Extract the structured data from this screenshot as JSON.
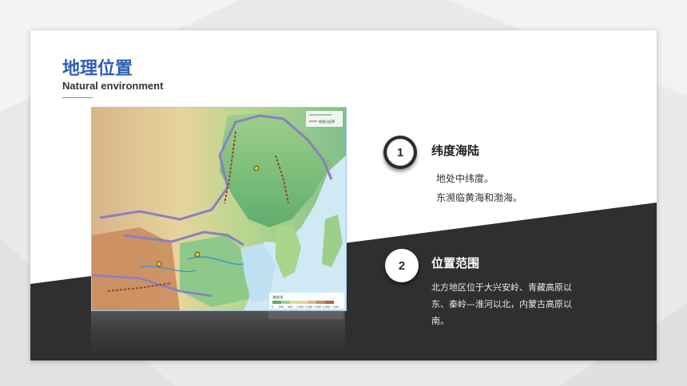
{
  "header": {
    "title": "地理位置",
    "subtitle": "Natural environment"
  },
  "map": {
    "legend_label": "地理分区界",
    "elevation_label": "海拔/米",
    "elevation_ticks": [
      "0",
      "200",
      "500",
      "1 000",
      "2 000",
      "3 000",
      "4 000",
      "7 000"
    ]
  },
  "points": [
    {
      "number": "1",
      "heading": "纬度海陆",
      "lines": [
        "地处中纬度。",
        "东濒临黄海和渤海。"
      ]
    },
    {
      "number": "2",
      "heading": "位置范围",
      "lines": [
        "北方地区位于大兴安岭、青藏高原以",
        "东、秦岭—淮河以北，内蒙古高原以",
        "南。"
      ]
    }
  ],
  "colors": {
    "title": "#2f5fb3",
    "dark_band": "#2f2f2f",
    "background": "#e9eaec"
  }
}
